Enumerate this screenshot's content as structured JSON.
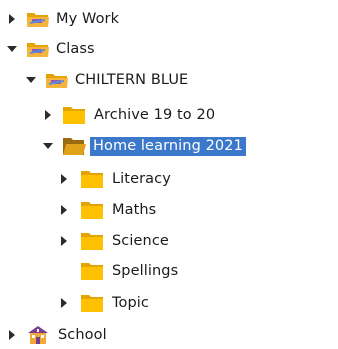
{
  "tree": {
    "items": [
      {
        "label": "My Work",
        "expanded": false,
        "icon": "shared-folder-icon",
        "selected": false
      },
      {
        "label": "Class",
        "expanded": true,
        "icon": "shared-folder-icon",
        "selected": false
      },
      {
        "label": "CHILTERN BLUE",
        "expanded": true,
        "icon": "shared-folder-icon",
        "selected": false
      },
      {
        "label": "Archive 19 to 20",
        "expanded": false,
        "icon": "folder-icon",
        "selected": false
      },
      {
        "label": "Home learning 2021",
        "expanded": true,
        "icon": "folder-open-icon",
        "selected": true
      },
      {
        "label": "Literacy",
        "expanded": false,
        "icon": "folder-icon",
        "selected": false
      },
      {
        "label": "Maths",
        "expanded": false,
        "icon": "folder-icon",
        "selected": false
      },
      {
        "label": "Science",
        "expanded": false,
        "icon": "folder-icon",
        "selected": false
      },
      {
        "label": "Spellings",
        "expanded": null,
        "icon": "folder-icon",
        "selected": false
      },
      {
        "label": "Topic",
        "expanded": false,
        "icon": "folder-icon",
        "selected": false
      },
      {
        "label": "School",
        "expanded": false,
        "icon": "school-icon",
        "selected": false
      }
    ]
  },
  "colors": {
    "folder": "#ffc000",
    "folder_dark": "#e3a400",
    "shared_folder": "#f5b43d",
    "selection": "#3b78c9",
    "arrow": "#2b2b2b",
    "school_roof": "#7a3e8f",
    "school_wall": "#f2a93b"
  }
}
